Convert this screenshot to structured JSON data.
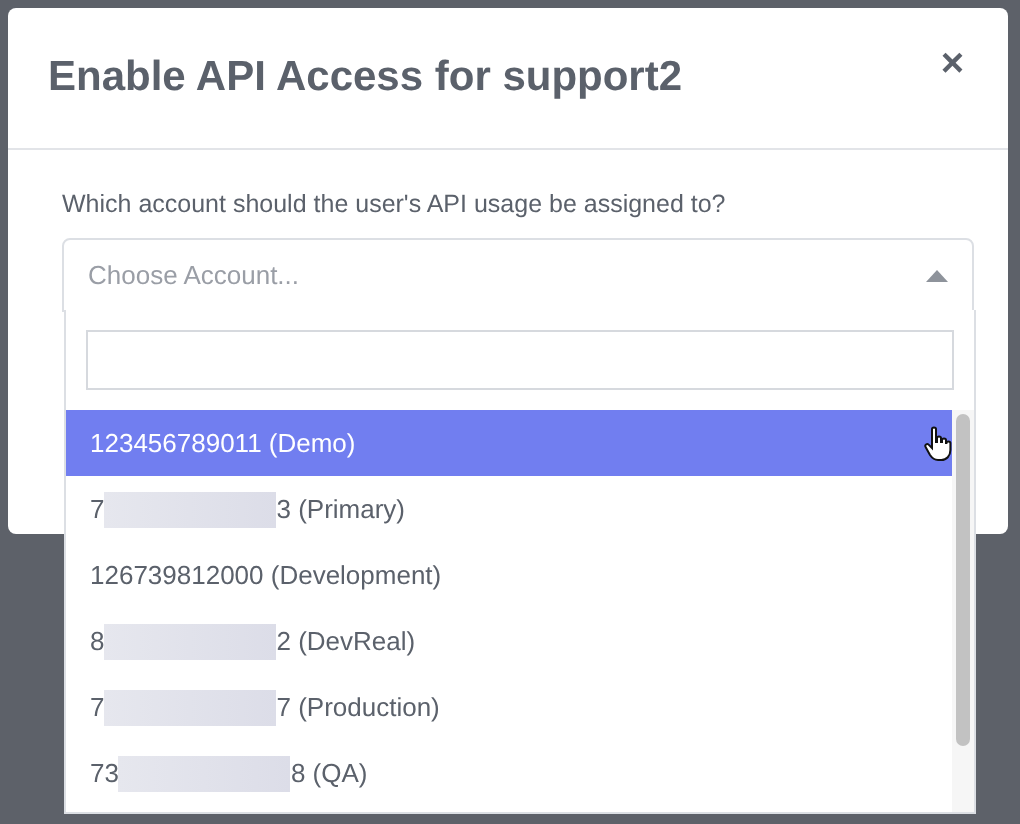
{
  "dialog": {
    "title": "Enable API Access for support2",
    "close": "×"
  },
  "question": "Which account should the user's API usage be assigned to?",
  "select": {
    "placeholder": "Choose Account...",
    "expanded": true,
    "options": [
      {
        "start": "123456789011 (Demo)",
        "redacted": false,
        "selected": true
      },
      {
        "start": "7",
        "redacted": true,
        "end": "3 (Primary)",
        "selected": false
      },
      {
        "start": "126739812000 (Development)",
        "redacted": false,
        "selected": false
      },
      {
        "start": "8",
        "redacted": true,
        "end": "2 (DevReal)",
        "selected": false
      },
      {
        "start": "7",
        "redacted": true,
        "end": "7 (Production)",
        "selected": false
      },
      {
        "start": "73",
        "redacted": true,
        "end": "8 (QA)",
        "selected": false
      }
    ]
  }
}
